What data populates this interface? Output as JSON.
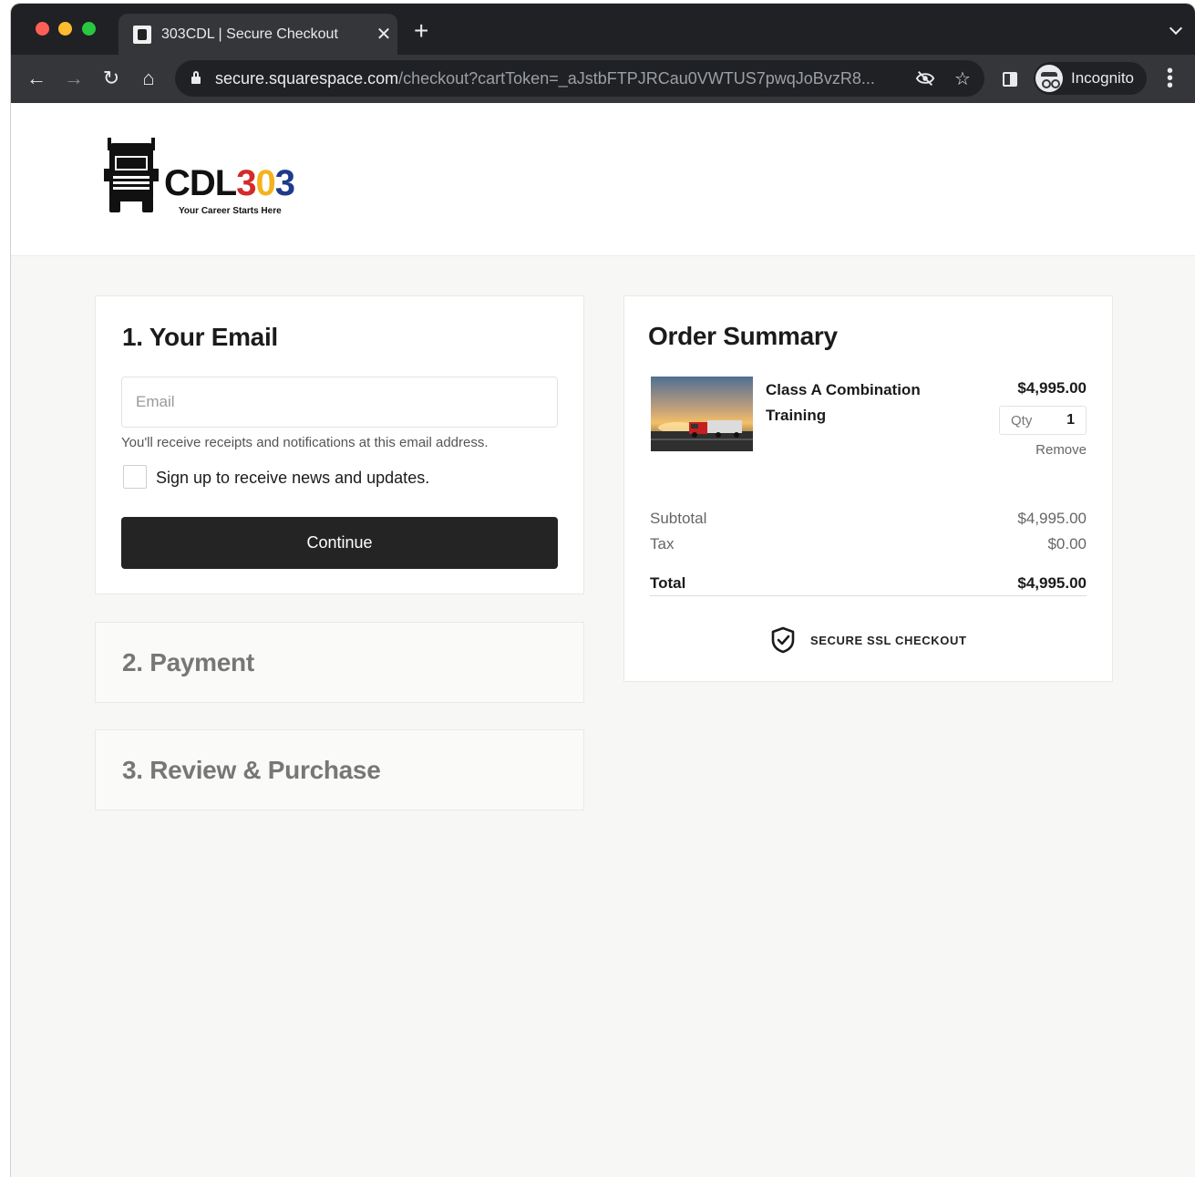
{
  "browser": {
    "tab_title": "303CDL | Secure Checkout",
    "url_host": "secure.squarespace.com",
    "url_path": "/checkout?cartToken=_aJstbFTPJRCau0VWTUS7pwqJoBvzR8...",
    "profile_label": "Incognito"
  },
  "site": {
    "logo": {
      "part1": "CDL",
      "part2": "3",
      "part3": "0",
      "part4": "3",
      "tagline": "Your Career Starts Here"
    }
  },
  "checkout": {
    "email_step": {
      "title": "1.  Your Email",
      "input_placeholder": "Email",
      "input_value": "",
      "helper_text": "You'll receive receipts and notifications at this email address.",
      "newsletter_label": "Sign up to receive news and updates.",
      "newsletter_checked": false,
      "continue_label": "Continue"
    },
    "payment_step": {
      "title": "2.  Payment"
    },
    "review_step": {
      "title": "3.  Review & Purchase"
    }
  },
  "order_summary": {
    "title": "Order Summary",
    "item": {
      "name": "Class A Combination Training",
      "price": "$4,995.00",
      "qty_label": "Qty",
      "qty": "1",
      "remove_label": "Remove"
    },
    "subtotal_label": "Subtotal",
    "subtotal_value": "$4,995.00",
    "tax_label": "Tax",
    "tax_value": "$0.00",
    "total_label": "Total",
    "total_value": "$4,995.00",
    "secure_label": "SECURE SSL CHECKOUT"
  },
  "colors": {
    "button_bg": "#242424",
    "logo_red": "#d42a2a",
    "logo_yellow": "#f3b31c",
    "logo_blue": "#1e3a8a",
    "chrome_dark": "#202124"
  },
  "icons": [
    "back-icon",
    "forward-icon",
    "reload-icon",
    "home-icon",
    "lock-icon",
    "eye-off-icon",
    "star-icon",
    "side-panel-icon",
    "incognito-icon",
    "menu-icon",
    "shield-check-icon",
    "truck-icon"
  ]
}
